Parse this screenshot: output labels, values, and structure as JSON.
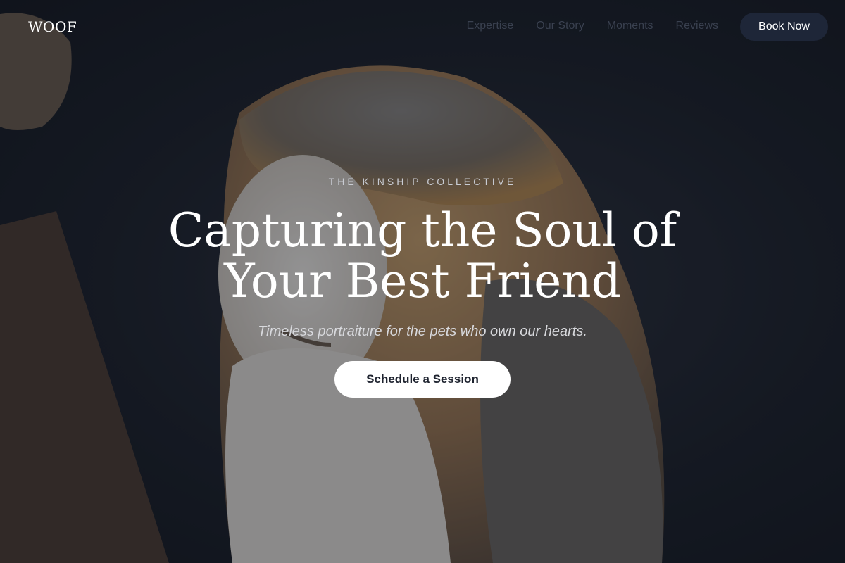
{
  "brand": {
    "logo": "WOOF"
  },
  "nav": {
    "items": [
      {
        "label": "Expertise"
      },
      {
        "label": "Our Story"
      },
      {
        "label": "Moments"
      },
      {
        "label": "Reviews"
      }
    ],
    "book_label": "Book Now"
  },
  "hero": {
    "eyebrow": "THE KINSHIP COLLECTIVE",
    "headline": "Capturing the Soul of Your Best Friend",
    "subtitle": "Timeless portraiture for the pets who own our hearts.",
    "cta_label": "Schedule a Session",
    "background_image": "barn-owl-photo"
  },
  "colors": {
    "button_dark": "#1e2638",
    "button_light": "#ffffff",
    "nav_text": "#3a4150"
  }
}
